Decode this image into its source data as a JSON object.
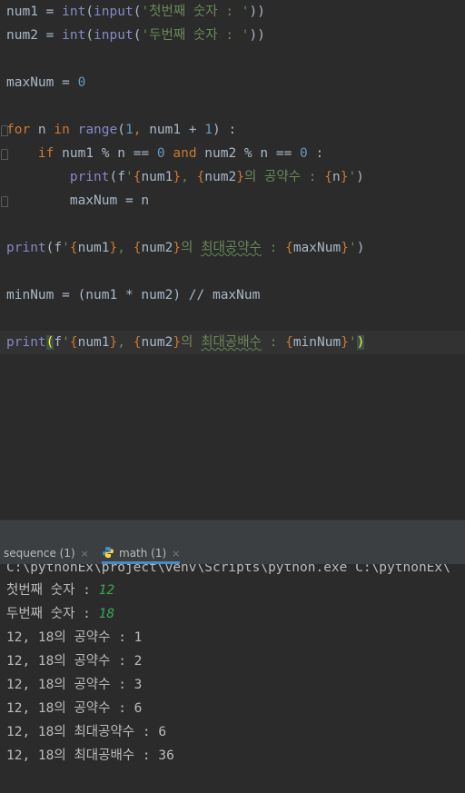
{
  "editor": {
    "lines": [
      {
        "parts": [
          [
            "",
            "num1 = "
          ],
          [
            "fn",
            "int"
          ],
          [
            "",
            "("
          ],
          [
            "fn",
            "input"
          ],
          [
            "",
            "("
          ],
          [
            "str",
            "'첫번째 숫자 : '"
          ],
          [
            "",
            "))"
          ]
        ]
      },
      {
        "parts": [
          [
            "",
            "num2 = "
          ],
          [
            "fn",
            "int"
          ],
          [
            "",
            "("
          ],
          [
            "fn",
            "input"
          ],
          [
            "",
            "("
          ],
          [
            "str",
            "'두번째 숫자 : '"
          ],
          [
            "",
            "))"
          ]
        ]
      },
      {
        "parts": []
      },
      {
        "parts": [
          [
            "",
            "maxNum = "
          ],
          [
            "num",
            "0"
          ]
        ]
      },
      {
        "parts": []
      },
      {
        "parts": [
          [
            "kw",
            "for "
          ],
          [
            "",
            "n "
          ],
          [
            "kw",
            "in "
          ],
          [
            "fn",
            "range"
          ],
          [
            "",
            "("
          ],
          [
            "num",
            "1"
          ],
          [
            "kw",
            ", "
          ],
          [
            "",
            "num1 + "
          ],
          [
            "num",
            "1"
          ],
          [
            "",
            ") :"
          ]
        ]
      },
      {
        "parts": [
          [
            "",
            "    "
          ],
          [
            "kw",
            "if "
          ],
          [
            "",
            "num1 % n == "
          ],
          [
            "num",
            "0"
          ],
          [
            "",
            " "
          ],
          [
            "kw",
            "and "
          ],
          [
            "",
            "num2 % n == "
          ],
          [
            "num",
            "0"
          ],
          [
            "",
            " :"
          ]
        ]
      },
      {
        "parts": [
          [
            "",
            "        "
          ],
          [
            "fn",
            "print"
          ],
          [
            "",
            "(f"
          ],
          [
            "str",
            "'"
          ],
          [
            "fs",
            "{"
          ],
          [
            "",
            "num1"
          ],
          [
            "fs",
            "}"
          ],
          [
            "str",
            ", "
          ],
          [
            "fs",
            "{"
          ],
          [
            "",
            "num2"
          ],
          [
            "fs",
            "}"
          ],
          [
            "str",
            "의 공약수 : "
          ],
          [
            "fs",
            "{"
          ],
          [
            "",
            "n"
          ],
          [
            "fs",
            "}"
          ],
          [
            "str",
            "'"
          ],
          [
            "",
            ")"
          ]
        ]
      },
      {
        "parts": [
          [
            "",
            "        maxNum = n"
          ]
        ]
      },
      {
        "parts": []
      },
      {
        "parts": [
          [
            "fn",
            "print"
          ],
          [
            "",
            "(f"
          ],
          [
            "str",
            "'"
          ],
          [
            "fs",
            "{"
          ],
          [
            "",
            "num1"
          ],
          [
            "fs",
            "}"
          ],
          [
            "str",
            ", "
          ],
          [
            "fs",
            "{"
          ],
          [
            "",
            "num2"
          ],
          [
            "fs",
            "}"
          ],
          [
            "str",
            "의 "
          ],
          [
            "str squig",
            "최대공약수"
          ],
          [
            "str",
            " : "
          ],
          [
            "fs",
            "{"
          ],
          [
            "",
            "maxNum"
          ],
          [
            "fs",
            "}"
          ],
          [
            "str",
            "'"
          ],
          [
            "",
            ")"
          ]
        ]
      },
      {
        "parts": []
      },
      {
        "parts": [
          [
            "",
            "minNum = (num1 * num2) // maxNum"
          ]
        ]
      },
      {
        "parts": []
      },
      {
        "parts": [
          [
            "fn",
            "print"
          ],
          [
            "brk",
            "("
          ],
          [
            "",
            "f"
          ],
          [
            "str",
            "'"
          ],
          [
            "fs",
            "{"
          ],
          [
            "",
            "num1"
          ],
          [
            "fs",
            "}"
          ],
          [
            "str",
            ", "
          ],
          [
            "fs",
            "{"
          ],
          [
            "",
            "num2"
          ],
          [
            "fs",
            "}"
          ],
          [
            "str",
            "의 "
          ],
          [
            "str squig",
            "최대공배수"
          ],
          [
            "str",
            " : "
          ],
          [
            "fs",
            "{"
          ],
          [
            "",
            "minNum"
          ],
          [
            "fs",
            "}"
          ],
          [
            "str",
            "'"
          ],
          [
            "brk",
            ")"
          ]
        ]
      }
    ]
  },
  "run_tabs": [
    {
      "label": "sequence (1)",
      "close": "×",
      "active": false,
      "icon": "none"
    },
    {
      "label": "math (1)",
      "close": "×",
      "active": true,
      "icon": "python-icon"
    }
  ],
  "console": {
    "command": "C:\\pythonEx\\project\\venv\\Scripts\\python.exe C:\\pythonEx\\",
    "prompt1": "첫번째 숫자 : ",
    "input1": "12",
    "prompt2": "두번째 숫자 : ",
    "input2": "18",
    "output": [
      "12, 18의 공약수 : 1",
      "12, 18의 공약수 : 2",
      "12, 18의 공약수 : 3",
      "12, 18의 공약수 : 6",
      "12, 18의 최대공약수 : 6",
      "12, 18의 최대공배수 : 36"
    ]
  },
  "colors": {
    "background": "#2b2b2b",
    "keyword": "#cc7832",
    "builtin": "#8888c6",
    "number": "#6897bb",
    "string": "#6a8759",
    "input_text": "#3aa556",
    "active_tab_underline": "#4a88c7"
  }
}
